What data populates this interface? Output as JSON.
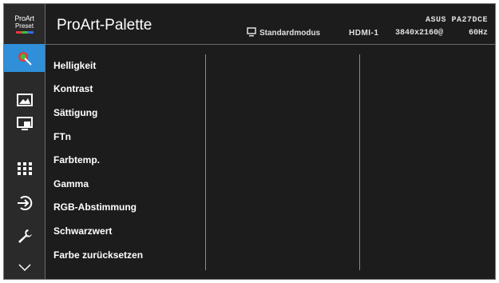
{
  "logo": {
    "line1": "ProArt",
    "line2": "Preset"
  },
  "sidebar": {
    "items": [
      {
        "icon": "color-icon",
        "active": true
      },
      {
        "icon": "image-icon",
        "active": false
      },
      {
        "icon": "pip-icon",
        "active": false
      },
      {
        "icon": "grid-icon",
        "active": false
      },
      {
        "icon": "input-select-icon",
        "active": false
      },
      {
        "icon": "wrench-icon",
        "active": false
      },
      {
        "icon": "chevron-down-icon",
        "active": false
      }
    ]
  },
  "header": {
    "title": "ProArt-Palette",
    "mode_icon": "monitor-icon",
    "mode": "Standardmodus",
    "input": "HDMI-1",
    "model": "ASUS PA27DCE",
    "resolution": "3840x2160@",
    "refresh": "60Hz"
  },
  "menu": {
    "items": [
      "Helligkeit",
      "Kontrast",
      "Sättigung",
      "FTn",
      "Farbtemp.",
      "Gamma",
      "RGB-Abstimmung",
      "Schwarzwert",
      "Farbe zurücksetzen"
    ]
  },
  "colors": {
    "accent": "#2f8fd8",
    "background": "#1c1c1c",
    "sidebar": "#2a2a2a",
    "text": "#ffffff"
  }
}
